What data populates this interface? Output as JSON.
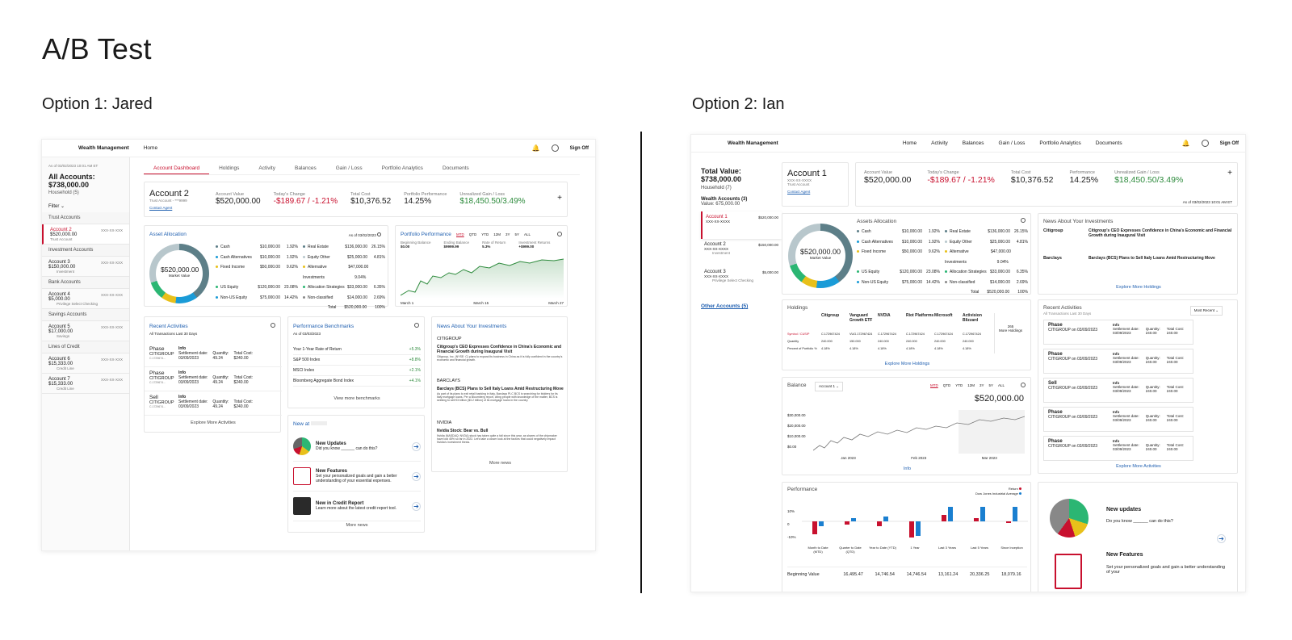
{
  "page": {
    "title": "A/B Test",
    "option1": "Option 1: Jared",
    "option2": "Option 2: Ian"
  },
  "colors": {
    "accent_red": "#c8102e",
    "link_blue": "#1f5fb0",
    "gain_green": "#2e8b3d",
    "donut": [
      "#5d7f88",
      "#1a9bd7",
      "#e8c01a",
      "#2bb673",
      "#b8c7cc"
    ]
  },
  "opt1": {
    "nav": {
      "brand": "Wealth Management",
      "home": "Home",
      "signout": "Sign Off"
    },
    "side": {
      "asof": "As of 03/02/2023 10:01 AM ET",
      "all": "All Accounts:",
      "total": "$738,000.00",
      "hh": "Household (5)",
      "filter": "Filter",
      "groups": [
        {
          "h": "Trust Accounts",
          "items": [
            {
              "name": "Account 2",
              "num": "XXX-XX-XXX",
              "val": "$520,000.00",
              "type": "Trust Account",
              "active": true
            }
          ]
        },
        {
          "h": "Investment Accounts",
          "items": [
            {
              "name": "Account 3",
              "num": "XXX-XX-XXX",
              "val": "$150,000.00",
              "type": "Investment"
            }
          ]
        },
        {
          "h": "Bank Accounts",
          "items": [
            {
              "name": "Account 4",
              "num": "XXX-XX-XXX",
              "val": "$5,000.00",
              "type": "Privilege Select Checking"
            }
          ]
        },
        {
          "h": "Savings Accounts",
          "items": [
            {
              "name": "Account 5",
              "num": "XXX-XX-XXX",
              "val": "$17,000.00",
              "type": "Savings"
            }
          ]
        },
        {
          "h": "Lines of Credit",
          "items": [
            {
              "name": "Account 6",
              "num": "XXX-XX-XXX",
              "val": "$15,333.00",
              "type": "Credit Line"
            },
            {
              "name": "Account 7",
              "num": "XXX-XX-XXX",
              "val": "$15,333.00",
              "type": "Credit Line"
            }
          ]
        }
      ]
    },
    "tabs": [
      "Account Dashboard",
      "Holdings",
      "Activity",
      "Balances",
      "Gain / Loss",
      "Portfolio Analytics",
      "Documents"
    ],
    "summary": {
      "name": "Account 2",
      "sub": "Trust Account - ***9999",
      "contact": "Contact Agent",
      "cols": [
        {
          "l": "Account Value",
          "v": "$520,000.00",
          "c": ""
        },
        {
          "l": "Today's Change",
          "v": "-$189.67 / -1.21%",
          "c": "red"
        },
        {
          "l": "Total Cost",
          "v": "$10,376.52",
          "c": ""
        },
        {
          "l": "Portfolio Performance",
          "v": "14.25%",
          "c": ""
        },
        {
          "l": "Unrealized Gain / Loss",
          "v": "$18,450.50/3.49%",
          "c": "green"
        }
      ],
      "plus": "+"
    },
    "alloc": {
      "title": "Asset Allocation",
      "asof": "As of 03/02/2023",
      "center": "$520,000.00",
      "centerSub": "Market Value",
      "left": [
        [
          "Cash",
          "$10,000.00",
          "1.92%"
        ],
        [
          "Cash Alternatives",
          "$10,000.00",
          "1.92%"
        ],
        [
          "Fixed Income",
          "$50,000.00",
          "9.62%"
        ],
        [
          "US Equity",
          "$120,000.00",
          "23.08%"
        ],
        [
          "Non-US Equity",
          "$75,000.00",
          "14.42%"
        ]
      ],
      "right": [
        [
          "Real Estate",
          "$136,000.00",
          "26.15%"
        ],
        [
          "Equity Other",
          "$25,000.00",
          "4.81%"
        ],
        [
          "Alternative Investments",
          "$47,000.00",
          "9.04%"
        ],
        [
          "Allocation Strategies",
          "$33,000.00",
          "6.35%"
        ],
        [
          "Non-classified",
          "$14,000.00",
          "2.69%"
        ]
      ],
      "total": [
        "Total",
        "$520,000.00",
        "100%"
      ]
    },
    "perf": {
      "title": "Portfolio Performance",
      "ranges": [
        "MTD",
        "QTD",
        "YTD",
        "12M",
        "3Y",
        "5Y",
        "ALL"
      ],
      "stats": [
        [
          "Beginning Balance",
          "$0.00"
        ],
        [
          "Ending Balance",
          "$9999.99"
        ],
        [
          "Rate of Return",
          "5.3%"
        ],
        [
          "Investment Returns",
          "+$999.00"
        ]
      ],
      "x": [
        "March 1",
        "March 15",
        "March 27"
      ]
    },
    "recent": {
      "title": "Recent Activities",
      "sub": "All Transactions Last 30 Days",
      "rows": [
        {
          "type": "Phase",
          "who": "CITIGROUP",
          "acct": "C.1729674...",
          "info": "Info",
          "setl": "Settlement date:",
          "date": "03/09/2023",
          "ql": "Quantity:",
          "q": "49.24",
          "tl": "Total Cost:",
          "t": "$240.00"
        },
        {
          "type": "Phase",
          "who": "CITIGROUP",
          "acct": "C.1729674...",
          "info": "Info",
          "setl": "Settlement date:",
          "date": "03/09/2023",
          "ql": "Quantity:",
          "q": "49.24",
          "tl": "Total Cost:",
          "t": "$240.00"
        },
        {
          "type": "Sell",
          "who": "CITIGROUP",
          "acct": "C.1729674...",
          "info": "Info",
          "setl": "Settlement date:",
          "date": "03/09/2023",
          "ql": "Quantity:",
          "q": "49.24",
          "tl": "Total Cost:",
          "t": "$240.00"
        }
      ],
      "more": "Explore More Activities"
    },
    "bench": {
      "title": "Performance Benchmarks",
      "asof": "As of 03/03/2023",
      "rows": [
        [
          "Your 1-Year Rate of Return",
          "+5.3%"
        ],
        [
          "S&P 500 Index",
          "+8.8%"
        ],
        [
          "MSCI Index",
          "+2.1%"
        ],
        [
          "Bloomberg Aggregate Bond Index",
          "+4.1%"
        ]
      ],
      "more": "View more benchmarks"
    },
    "newat": {
      "title": "New at",
      "items": [
        {
          "t": "New Updates",
          "d": "Did you know ______ can do this?"
        },
        {
          "t": "New Features",
          "d": "Set your personalized goals and gain a better understanding of your essential expenses."
        },
        {
          "t": "New in Credit Report",
          "d": "Learn more about the latest credit report tool."
        }
      ],
      "more": "More news"
    },
    "news": {
      "title": "News About Your Investments",
      "items": [
        {
          "src": "CITIGROUP",
          "h": "Citigroup's CEO Expresses Confidence in China's Economic and Financial Growth during Inaugural Visit",
          "b": "Citigroup, Inc. (NYSE: C) plans to expand its business in China as it is fully confident in the country's economic and financial growth."
        },
        {
          "src": "BARCLAYS",
          "h": "Barclays (BCS) Plans to Sell Italy Loans Amid Restructuring Move",
          "b": "As part of its plans to exit retail banking in Italy, Barclays PLC BCS is searching for bidders for its Italy mortgage loans. Per a Bloomberg report, citing people with knowledge of the matter, BCS is seeking to sell €3 billion ($3.2 billion) of its mortgage loans in the country."
        },
        {
          "src": "NVIDIA",
          "h": "Nvidia Stock: Bear vs. Bull",
          "b": "Nvidia (NASDAQ: NVDA) stock has taken quite a fall since this year, as shares of the chipmaker have lost 45% so far in 2022. Let's take a closer look at the factors that could negatively impact Nvidia's investment thesis."
        }
      ],
      "more": "More news"
    }
  },
  "opt2": {
    "nav": {
      "brand": "Wealth Management",
      "links": [
        "Home",
        "Activity",
        "Balances",
        "Gain / Loss",
        "Portfolio Analytics",
        "Documents"
      ],
      "signout": "Sign Off"
    },
    "side": {
      "tvl": "Total Value:",
      "tv": "$738,000.00",
      "hh": "Household (7)",
      "wa": "Wealth Accounts (3)",
      "wav": "Value: 675,000.00",
      "accts": [
        {
          "n": "Account 1",
          "v": "$520,000.00",
          "num": "XXX-XX-XXXX",
          "t": "",
          "active": true
        },
        {
          "n": "Account 2",
          "v": "$150,000.00",
          "num": "XXX-XX-XXXX",
          "t": "Investment"
        },
        {
          "n": "Account 3",
          "v": "$5,000.00",
          "num": "XXX-XX-XXXX",
          "t": "Privilege Select Checking"
        }
      ],
      "other": "Other Accounts (5)"
    },
    "acct": {
      "name": "Account 1",
      "num": "XXX-XX-XXXX",
      "type": "Trust Account",
      "contact": "Contact Agent"
    },
    "summary": {
      "cols": [
        {
          "l": "Account Value",
          "v": "$520,000.00",
          "c": ""
        },
        {
          "l": "Today's Change",
          "v": "-$189.67 / -1.21%",
          "c": "red"
        },
        {
          "l": "Total Cost",
          "v": "$10,376.52",
          "c": ""
        },
        {
          "l": "Performance",
          "v": "14.25%",
          "c": ""
        },
        {
          "l": "Unrealized Gain / Loss",
          "v": "$18,450.50/3.49%",
          "c": "green"
        }
      ],
      "asof": "As of 03/02/2023 10:01 AM ET",
      "plus": "+"
    },
    "alloc": {
      "title": "Assets Allocation",
      "center": "$520,000.00",
      "centerSub": "Market Value"
    },
    "news": {
      "title": "News About Your Investments",
      "items": [
        {
          "src": "Citigroup",
          "h": "Citigroup's CEO Expresses Confidence in China's Economic and Financial Growth during Inaugural Visit"
        },
        {
          "src": "Barclays",
          "h": "Barclays (BCS) Plans to Sell Italy Loans Amid Restructuring Move"
        }
      ],
      "more": "Explore More Holdings"
    },
    "holdings": {
      "title": "Holdings",
      "cols": [
        "Citigroup",
        "Vanguard Growth ETF",
        "NVDIA",
        "Riot Platforms",
        "Microsoft",
        "Activision Blizzard"
      ],
      "rows": [
        {
          "l": "Symbol / CUSIP",
          "v": [
            "C.172967424",
            "VUG.172967424",
            "C.172967424",
            "C.172967424",
            "C.172967424",
            "C.172967424"
          ]
        },
        {
          "l": "Quantity",
          "v": [
            "240.000",
            "150.000",
            "240.000",
            "240.000",
            "240.000",
            "240.000"
          ]
        },
        {
          "l": "Percent of Portfolio %",
          "v": [
            "4.18%",
            "4.18%",
            "4.18%",
            "4.18%",
            "4.18%",
            "4.18%"
          ]
        }
      ],
      "morecount": "265",
      "morelbl": "More Holdings",
      "more": "Explore More Holdings"
    },
    "recent": {
      "title": "Recent Activities",
      "sub": "All Transactions Last 30 Days",
      "sort": "Most Recent",
      "rows": [
        {
          "t": "Phase",
          "d": "CITIGROUP on 03/09/2023"
        },
        {
          "t": "Phase",
          "d": "CITIGROUP on 03/09/2023"
        },
        {
          "t": "Sell",
          "d": "CITIGROUP on 03/09/2023"
        },
        {
          "t": "Phase",
          "d": "CITIGROUP on 03/09/2023"
        },
        {
          "t": "Phase",
          "d": "CITIGROUP on 03/09/2023"
        }
      ],
      "info": "Info",
      "sl": "Settlement date:",
      "sd": "03/09/2023",
      "ql": "Quantity:",
      "q": "240.00",
      "cl": "Total Cost:",
      "c": "240.00",
      "more": "Explore More Activities"
    },
    "balance": {
      "title": "Balance",
      "acct": "Account 1",
      "ranges": [
        "MTD",
        "QTD",
        "YTD",
        "12M",
        "3Y",
        "5Y",
        "ALL"
      ],
      "value": "$520,000.00",
      "y": [
        "$30,000.00",
        "$20,000.00",
        "$10,000.00",
        "$0.00"
      ],
      "x": [
        "Jan 2023",
        "Feb 2023",
        "Mar 2023"
      ],
      "info": "Info"
    },
    "perf": {
      "title": "Performance",
      "y": [
        "10%",
        "0",
        "-10%"
      ],
      "legend": [
        "Return",
        "Dow Jones Industrial Average"
      ],
      "cats": [
        "Month to Date (MTD)",
        "Quarter to Date (QTD)",
        "Year to Date (YTD)",
        "1 Year",
        "Last 3 Years",
        "Last 5 Years",
        "Since Inception"
      ],
      "table": {
        "label": "Beginning Value",
        "vals": [
          "16,495.47",
          "14,746.54",
          "14,746.54",
          "13,161.24",
          "20,336.25",
          "18,079.16"
        ]
      }
    },
    "updates": {
      "t": "New updates",
      "d": "Do you know ______ can do this?",
      "t2": "New Features",
      "d2": "Set your personalized goals and gain a better understanding of your"
    }
  }
}
